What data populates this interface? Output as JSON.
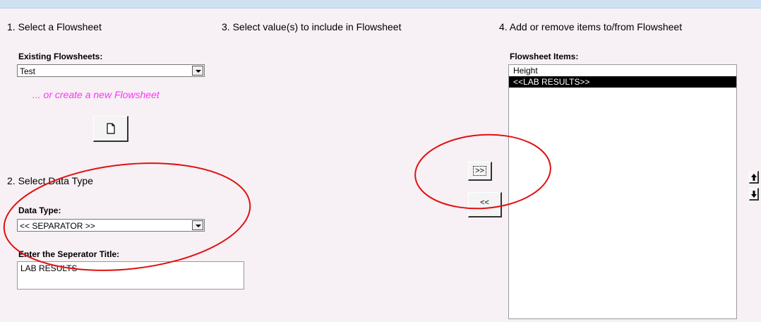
{
  "step1": {
    "title": "1. Select a  Flowsheet",
    "existing_label": "Existing Flowsheets:",
    "existing_value": "Test",
    "create_new_text": "... or create a new  Flowsheet",
    "new_icon": "new-document-icon"
  },
  "step2": {
    "title": "2. Select Data Type",
    "data_type_label": "Data Type:",
    "data_type_value": "<< SEPARATOR >>",
    "separator_title_label": "Enter the Seperator Title:",
    "separator_title_value": "LAB RESULTS"
  },
  "step3": {
    "title": "3. Select value(s) to include in Flowsheet",
    "add_button": ">>",
    "remove_button": "<<"
  },
  "step4": {
    "title": "4. Add or remove items to/from Flowsheet",
    "items_label": "Flowsheet Items:",
    "items": [
      "Height",
      "<<LAB RESULTS>>"
    ],
    "selected_index": 1,
    "move_up_icon": "arrow-up-icon",
    "move_down_icon": "arrow-down-icon"
  },
  "annotation_color": "#e01010"
}
